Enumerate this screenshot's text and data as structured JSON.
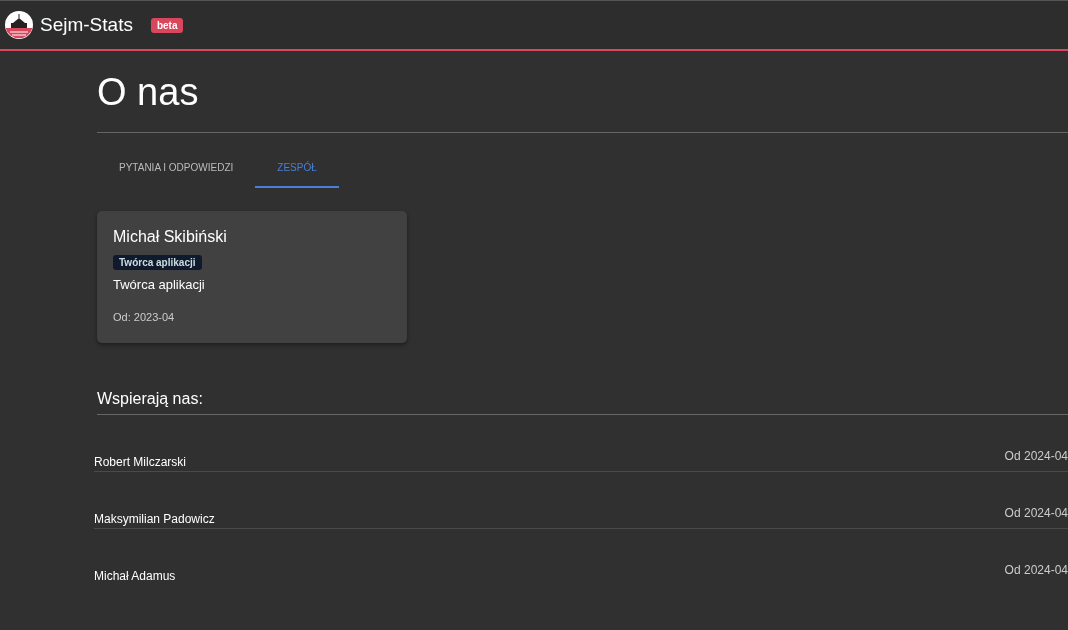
{
  "header": {
    "title": "Sejm-Stats",
    "badge": "beta"
  },
  "page": {
    "title": "O nas"
  },
  "tabs": [
    {
      "label": "PYTANIA I ODPOWIEDZI",
      "selected": false
    },
    {
      "label": "ZESPÓŁ",
      "selected": true
    }
  ],
  "team": [
    {
      "name": "Michał Skibiński",
      "role_badge": "Twórca aplikacji",
      "role": "Twórca aplikacji",
      "since": "Od: 2023-04"
    }
  ],
  "supporters": {
    "title": "Wspierają nas:",
    "items": [
      {
        "name": "Robert Milczarski",
        "since": "Od 2024-04"
      },
      {
        "name": "Maksymilian Padowicz",
        "since": "Od 2024-04"
      },
      {
        "name": "Michał Adamus",
        "since": "Od 2024-04"
      }
    ]
  }
}
